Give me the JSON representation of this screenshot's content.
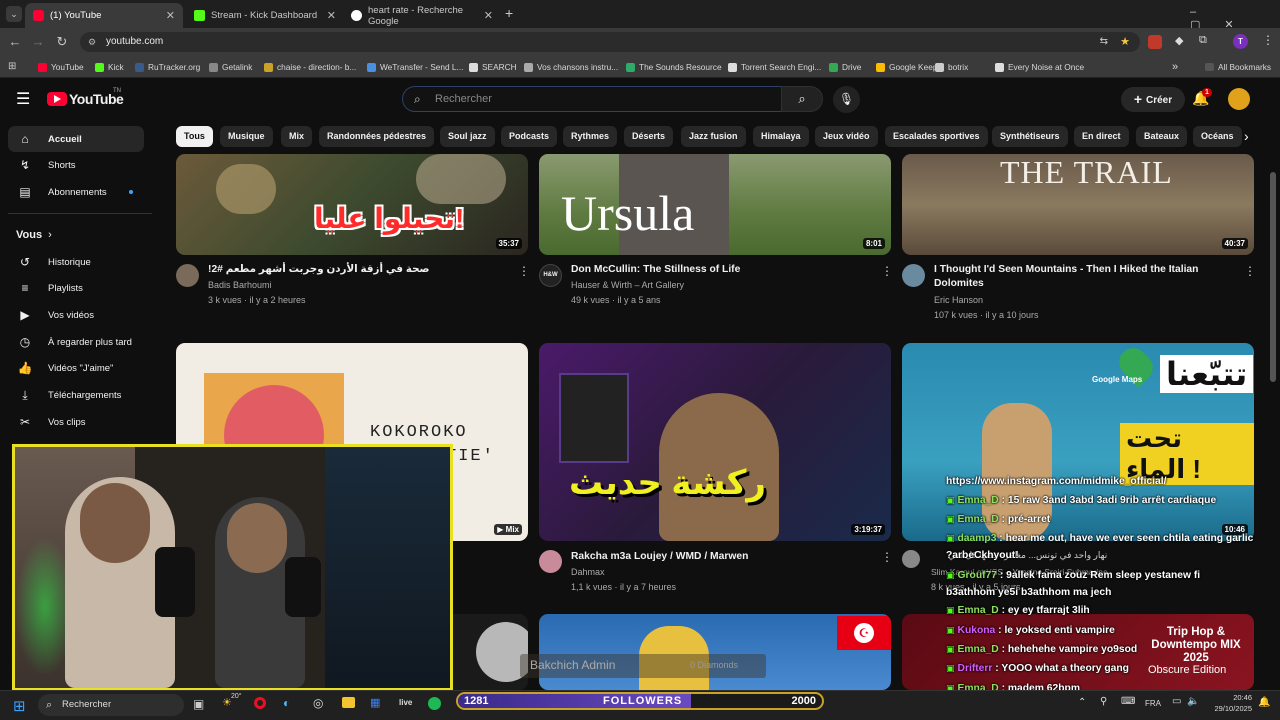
{
  "browser": {
    "tabs": [
      {
        "title": "(1) YouTube",
        "active": true
      },
      {
        "title": "Stream - Kick Dashboard",
        "active": false
      },
      {
        "title": "heart rate - Recherche Google",
        "active": false
      }
    ],
    "url": "youtube.com",
    "bookmarks": [
      "YouTube",
      "Kick",
      "RuTracker.org",
      "Getalink",
      "chaise - direction- b...",
      "WeTransfer - Send L...",
      "SEARCH",
      "Vos chansons instru...",
      "The Sounds Resource",
      "Torrent Search Engi...",
      "Drive",
      "Google Keep",
      "botrix",
      "Every Noise at Once"
    ],
    "all_bookmarks": "All Bookmarks",
    "profile_initial": "T"
  },
  "youtube": {
    "logo": "YouTube",
    "logo_sup": "TN",
    "search_placeholder": "Rechercher",
    "create_label": "Créer",
    "notif_count": "1",
    "sidebar": {
      "main": [
        "Accueil",
        "Shorts",
        "Abonnements"
      ],
      "you_header": "Vous",
      "you_items": [
        "Historique",
        "Playlists",
        "Vos vidéos",
        "À regarder plus tard",
        "Vidéos \"J'aime\"",
        "Téléchargements",
        "Vos clips"
      ]
    },
    "chips": [
      "Tous",
      "Musique",
      "Mix",
      "Randonnées pédestres",
      "Soul jazz",
      "Podcasts",
      "Rythmes",
      "Déserts",
      "Jazz fusion",
      "Himalaya",
      "Jeux vidéo",
      "Escalades sportives",
      "Synthétiseurs",
      "En direct",
      "Bateaux",
      "Océans"
    ],
    "videos": [
      {
        "title": "صحة في أزقة الأردن وجربت أشهر مطعم #2!",
        "overlay": "تحيلوا عليا!",
        "channel": "Badis Barhoumi",
        "meta": "3 k vues · il y a 2 heures",
        "duration": "35:37"
      },
      {
        "title": "Don McCullin: The Stillness of Life",
        "overlay": "Ursula",
        "channel": "Hauser & Wirth – Art Gallery",
        "meta": "49 k vues · il y a 5 ans",
        "duration": "8:01",
        "avatar_text": "H&W"
      },
      {
        "title": "I Thought I'd Seen Mountains - Then I Hiked the Italian Dolomites",
        "overlay": "THE TRAIL",
        "channel": "Eric Hanson",
        "meta": "107 k vues · il y a 10 jours",
        "duration": "40:37"
      },
      {
        "title": "",
        "overlay": "KOKOROKO",
        "overlay2": "TIE'",
        "channel": "",
        "meta": "",
        "duration": "Mix"
      },
      {
        "title": "Rakcha m3a Loujey / WMD / Marwen",
        "overlay": "ركشة حديث",
        "channel": "Dahmax",
        "meta": "1,1 k vues · il y a 7 heures",
        "duration": "3:19:37"
      },
      {
        "title": "نهار واحد في تونس... مغامرة تحتها كل شي",
        "overlay": "تتبّعنا",
        "overlay2": "تحت الماء !",
        "overlay3": "Google Maps",
        "channel": "Slim Karoui et YSS – Yassine Srairi Submarine",
        "meta": "8 k vues · il y a 5 jours",
        "duration": "10:46"
      },
      {
        "title": "",
        "overlay": "",
        "channel": "",
        "meta": "",
        "duration": ""
      },
      {
        "title": "",
        "overlay": "Bakchich Admin",
        "overlay2": "0 Diamonds",
        "channel": "",
        "meta": "",
        "duration": ""
      },
      {
        "title": "",
        "overlay": "Trip Hop & Downtempo MIX 2025",
        "overlay2": "Obscure Edition",
        "channel": "",
        "meta": "",
        "duration": ""
      }
    ]
  },
  "chat": [
    {
      "user": "",
      "text": "https://www.instagram.com/midmike_official/"
    },
    {
      "user": "Emna_D",
      "text": "15 raw 3and 3abd 3adi 9rib arrêt cardiaque"
    },
    {
      "user": "Emna_D",
      "text": "pré-arret"
    },
    {
      "user": "daamp3",
      "text": "hear me out, have we ever seen chtila eating garlic"
    },
    {
      "user": "",
      "text": "?arbeCkhyout!"
    },
    {
      "user": "Grouf77",
      "text": "9allek fama zouz Rem sleep yestanew fi"
    },
    {
      "user": "",
      "text": "b3athhom ye5i b3athhom ma jech"
    },
    {
      "user": "Emna_D",
      "text": "ey ey tfarrajt 3lih"
    },
    {
      "user": "Kukona",
      "text": "le yoksed enti vampire"
    },
    {
      "user": "Emna_D",
      "text": "hehehehe vampire yo9sod"
    },
    {
      "user": "Drifterr",
      "text": "YOOO what a theory gang"
    },
    {
      "user": "Emna_D",
      "text": "madem 62bpm"
    },
    {
      "user": "daamp3",
      "text": ""
    }
  ],
  "stream": {
    "followers_label": "FOLLOWERS",
    "followers_current": "1281",
    "followers_goal": "2000",
    "followers_progress": 0.64
  },
  "taskbar": {
    "search": "Rechercher",
    "weather": "20°",
    "lang": "FRA",
    "time": "20:46",
    "date": "29/10/2025"
  }
}
